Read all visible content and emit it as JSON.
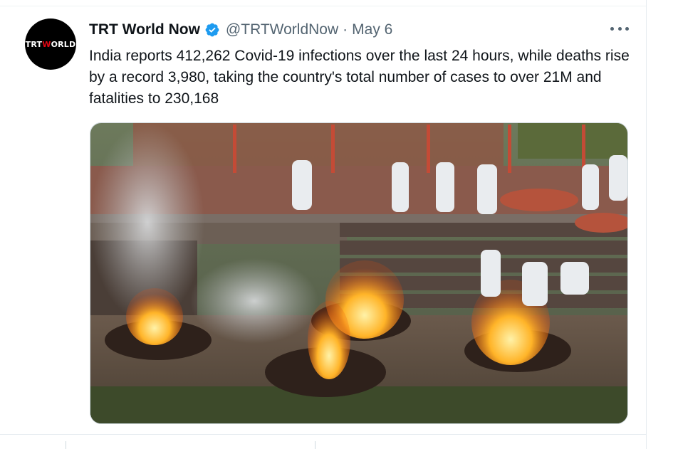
{
  "tweet": {
    "author_name": "TRT World Now",
    "handle": "@TRTWorldNow",
    "separator": "·",
    "date": "May 6",
    "text": "India reports 412,262 Covid-19 infections over the last 24 hours, while deaths rise by a record 3,980, taking the country's total number of cases to over 21M and fatalities to 230,168",
    "avatar": {
      "logo_text_left": "TRT",
      "logo_text_right": "WORLD",
      "accent_color": "#e30613"
    },
    "verified_color": "#1d9bf0"
  },
  "icons": {
    "verified": "verified-badge-icon",
    "more": "more-options-icon"
  },
  "colors": {
    "text": "#0f1419",
    "secondary": "#536471",
    "border": "#cfd9de"
  }
}
